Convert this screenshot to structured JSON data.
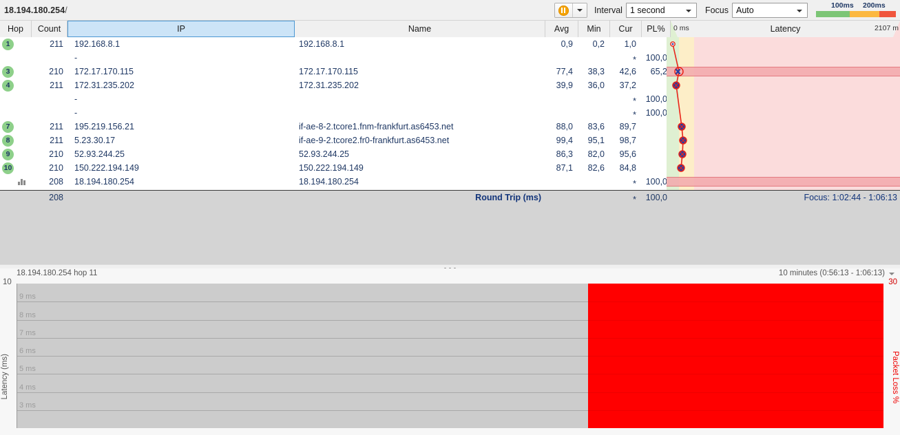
{
  "toolbar": {
    "target": "18.194.180.254",
    "target_suffix": "/",
    "pause_icon": "pause-icon",
    "interval_label": "Interval",
    "interval_value": "1 second",
    "focus_label": "Focus",
    "focus_value": "Auto",
    "legend": {
      "low": "100ms",
      "high": "200ms",
      "green": "#7cc576",
      "yellow": "#fcb840",
      "red": "#f0553d"
    }
  },
  "table": {
    "columns": [
      "Hop",
      "Count",
      "IP",
      "Name",
      "Avg",
      "Min",
      "Cur",
      "PL%",
      "Latency"
    ],
    "sorted_column": "IP",
    "latency_axis": {
      "min": "0 ms",
      "max": "2107 m"
    },
    "rows": [
      {
        "hop": "1",
        "count": "211",
        "ip": "192.168.8.1",
        "name": "192.168.8.1",
        "avg": "0,9",
        "min": "0,2",
        "cur": "1,0",
        "pl": ""
      },
      {
        "hop": "",
        "count": "",
        "ip": "-",
        "name": "",
        "avg": "",
        "min": "",
        "cur": "*",
        "pl": "100,0"
      },
      {
        "hop": "3",
        "count": "210",
        "ip": "172.17.170.115",
        "name": "172.17.170.115",
        "avg": "77,4",
        "min": "38,3",
        "cur": "42,6",
        "pl": "65,2"
      },
      {
        "hop": "4",
        "count": "211",
        "ip": "172.31.235.202",
        "name": "172.31.235.202",
        "avg": "39,9",
        "min": "36,0",
        "cur": "37,2",
        "pl": ""
      },
      {
        "hop": "",
        "count": "",
        "ip": "-",
        "name": "",
        "avg": "",
        "min": "",
        "cur": "*",
        "pl": "100,0"
      },
      {
        "hop": "",
        "count": "",
        "ip": "-",
        "name": "",
        "avg": "",
        "min": "",
        "cur": "*",
        "pl": "100,0"
      },
      {
        "hop": "7",
        "count": "211",
        "ip": "195.219.156.21",
        "name": "if-ae-8-2.tcore1.fnm-frankfurt.as6453.net",
        "avg": "88,0",
        "min": "83,6",
        "cur": "89,7",
        "pl": ""
      },
      {
        "hop": "8",
        "count": "211",
        "ip": "5.23.30.17",
        "name": "if-ae-9-2.tcore2.fr0-frankfurt.as6453.net",
        "avg": "99,4",
        "min": "95,1",
        "cur": "98,7",
        "pl": ""
      },
      {
        "hop": "9",
        "count": "210",
        "ip": "52.93.244.25",
        "name": "52.93.244.25",
        "avg": "86,3",
        "min": "82,0",
        "cur": "95,6",
        "pl": ""
      },
      {
        "hop": "10",
        "count": "210",
        "ip": "150.222.194.149",
        "name": "150.222.194.149",
        "avg": "87,1",
        "min": "82,6",
        "cur": "84,8",
        "pl": ""
      },
      {
        "hop": "chart-icon",
        "count": "208",
        "ip": "18.194.180.254",
        "name": "18.194.180.254",
        "avg": "",
        "min": "",
        "cur": "*",
        "pl": "100,0"
      }
    ]
  },
  "summary": {
    "count": "208",
    "round_trip_label": "Round Trip (ms)",
    "avg": "",
    "min": "",
    "cur": "*",
    "pl": "100,0",
    "focus_range": "Focus: 1:02:44 - 1:06:13"
  },
  "chart": {
    "title": "18.194.180.254 hop 11",
    "range": "10 minutes (0:56:13 - 1:06:13)",
    "y_left_title": "Latency (ms)",
    "y_left_top": "10",
    "y_right_title": "Packet Loss %",
    "y_right_top": "30",
    "gridline_labels": [
      "9 ms",
      "8 ms",
      "7 ms",
      "6 ms",
      "5 ms",
      "4 ms",
      "3 ms"
    ]
  },
  "chart_data": {
    "type": "area",
    "title": "18.194.180.254 hop 11",
    "xlabel": "10 minutes (0:56:13 - 1:06:13)",
    "ylabel": "Latency (ms)",
    "y2label": "Packet Loss %",
    "ylim": [
      3,
      10
    ],
    "y2lim": [
      0,
      30
    ],
    "ytick_labels": [
      "9 ms",
      "8 ms",
      "7 ms",
      "6 ms",
      "5 ms",
      "4 ms",
      "3 ms"
    ],
    "grid": true,
    "series": [
      {
        "name": "Packet Loss %",
        "color": "#ff0000",
        "x_start_fraction": 0.659,
        "x_end_fraction": 1.0,
        "value": 30
      }
    ]
  },
  "latency_plot": {
    "type": "line",
    "axis_min_ms": 0,
    "axis_max_ms": 2107,
    "points": [
      {
        "hop": 1,
        "ms": 1.0,
        "marker": "open"
      },
      {
        "hop": 3,
        "ms": 42.6,
        "marker": "selected"
      },
      {
        "hop": 4,
        "ms": 37.2,
        "marker": "filled"
      },
      {
        "hop": 7,
        "ms": 89.7,
        "marker": "filled"
      },
      {
        "hop": 8,
        "ms": 98.7,
        "marker": "filled"
      },
      {
        "hop": 9,
        "ms": 95.6,
        "marker": "filled"
      },
      {
        "hop": 10,
        "ms": 84.8,
        "marker": "filled"
      }
    ],
    "loss_rows": [
      3,
      11
    ]
  }
}
